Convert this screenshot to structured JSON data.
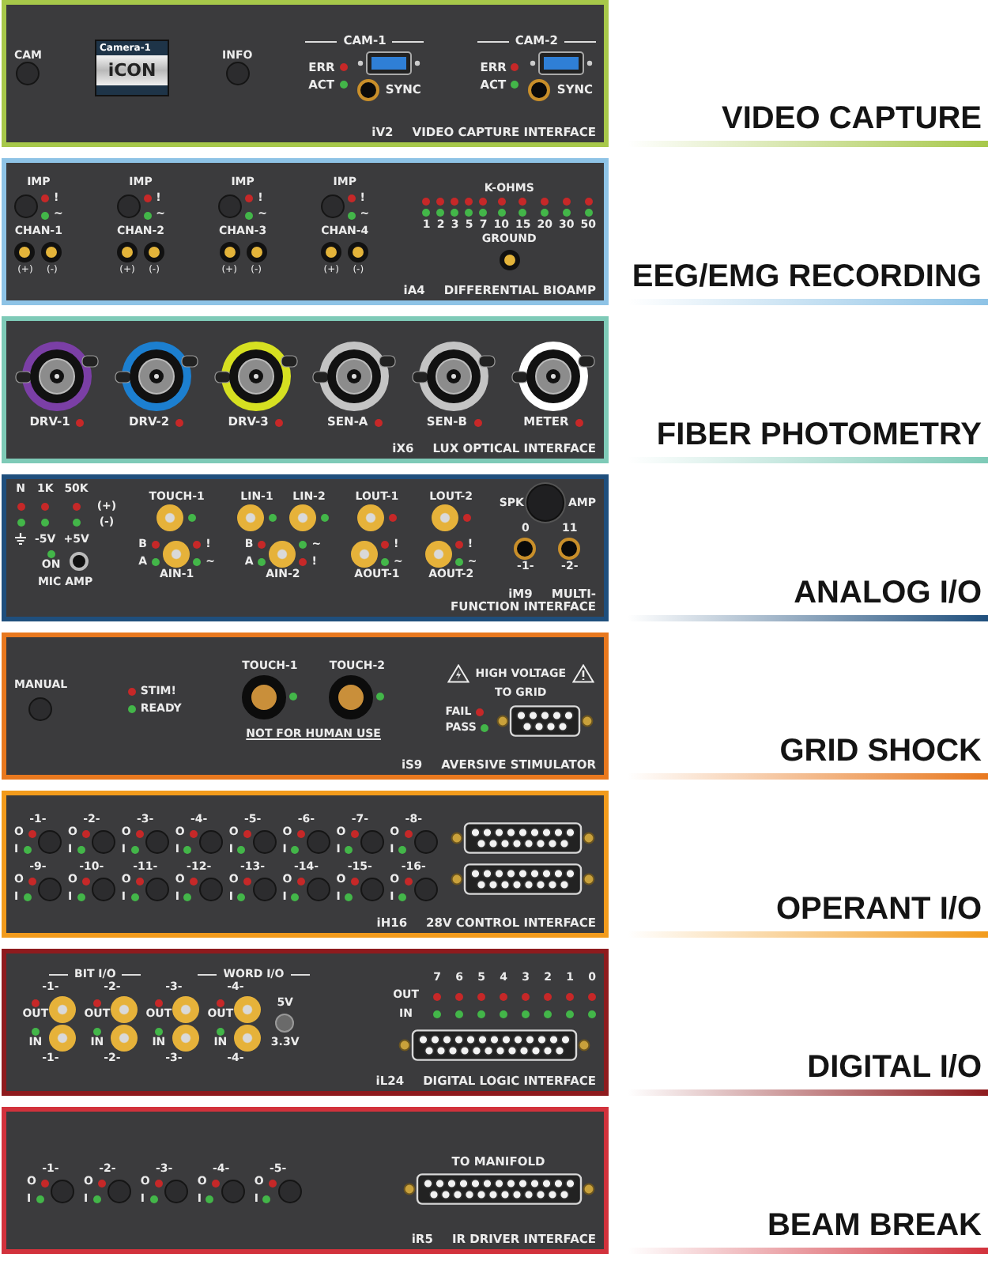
{
  "modules": [
    {
      "kind": "video",
      "color": "#a7c84a",
      "category": "VIDEO CAPTURE",
      "model": "iV2",
      "name": "VIDEO CAPTURE INTERFACE",
      "buttons": [
        "CAM",
        "INFO"
      ],
      "display": {
        "caption": "Camera-1",
        "logo": "iCON"
      },
      "cams": [
        {
          "label": "CAM-1",
          "leds": [
            {
              "label": "ERR",
              "color": "#c62828"
            },
            {
              "label": "ACT",
              "color": "#43b649"
            }
          ],
          "sync": "SYNC"
        },
        {
          "label": "CAM-2",
          "leds": [
            {
              "label": "ERR",
              "color": "#c62828"
            },
            {
              "label": "ACT",
              "color": "#43b649"
            }
          ],
          "sync": "SYNC"
        }
      ]
    },
    {
      "kind": "bioamp",
      "color": "#8ec3e6",
      "category": "EEG/EMG RECORDING",
      "model": "iA4",
      "name": "DIFFERENTIAL BIOAMP",
      "channels": [
        {
          "imp": "IMP",
          "leds": [
            {
              "label": "!",
              "color": "#c62828"
            },
            {
              "label": "~",
              "color": "#43b649"
            }
          ],
          "label": "CHAN-1",
          "jacks": [
            "(+)",
            "(-)"
          ]
        },
        {
          "imp": "IMP",
          "leds": [
            {
              "label": "!",
              "color": "#c62828"
            },
            {
              "label": "~",
              "color": "#43b649"
            }
          ],
          "label": "CHAN-2",
          "jacks": [
            "(+)",
            "(-)"
          ]
        },
        {
          "imp": "IMP",
          "leds": [
            {
              "label": "!",
              "color": "#c62828"
            },
            {
              "label": "~",
              "color": "#43b649"
            }
          ],
          "label": "CHAN-3",
          "jacks": [
            "(+)",
            "(-)"
          ]
        },
        {
          "imp": "IMP",
          "leds": [
            {
              "label": "!",
              "color": "#c62828"
            },
            {
              "label": "~",
              "color": "#43b649"
            }
          ],
          "label": "CHAN-4",
          "jacks": [
            "(+)",
            "(-)"
          ]
        }
      ],
      "scale": {
        "title": "K-OHMS",
        "values": [
          "1",
          "2",
          "3",
          "5",
          "7",
          "10",
          "15",
          "20",
          "30",
          "50"
        ],
        "leds": [
          {
            "color": "#c62828"
          },
          {
            "color": "#43b649"
          }
        ]
      },
      "ground": "GROUND"
    },
    {
      "kind": "fiber",
      "color": "#7ecab7",
      "category": "FIBER PHOTOMETRY",
      "model": "iX6",
      "name": "LUX OPTICAL INTERFACE",
      "ports": [
        {
          "label": "DRV-1",
          "color": "#7b3fa6"
        },
        {
          "label": "DRV-2",
          "color": "#1c7fd0"
        },
        {
          "label": "DRV-3",
          "color": "#d6e021"
        },
        {
          "label": "SEN-A",
          "color": "#c4c4c4"
        },
        {
          "label": "SEN-B",
          "color": "#c4c4c4"
        },
        {
          "label": "METER",
          "color": "#ffffff"
        }
      ]
    },
    {
      "kind": "analog",
      "color": "#1f4f7d",
      "category": "ANALOG I/O",
      "model": "iM9",
      "name": "MULTI-",
      "name_2": "FUNCTION INTERFACE",
      "mic": {
        "headers": [
          "N",
          "1K",
          "50K"
        ],
        "rows": [
          {
            "label": "(+)",
            "color": "#c62828"
          },
          {
            "label": "(-)",
            "color": "#43b649"
          }
        ],
        "supply": [
          "-5V",
          "+5V"
        ],
        "on": {
          "label": "ON",
          "color": "#43b649"
        },
        "caption": "MIC AMP"
      },
      "groups": [
        {
          "top": [
            {
              "label": "TOUCH-1",
              "color": "#43b649"
            }
          ],
          "bottom": [
            {
              "label": "AIN-1",
              "left": [
                {
                  "label": "B",
                  "color": "#c62828"
                },
                {
                  "label": "A",
                  "color": "#43b649"
                }
              ],
              "right": [
                {
                  "label": "!",
                  "color": "#c62828"
                },
                {
                  "label": "~",
                  "color": "#43b649"
                }
              ]
            }
          ]
        },
        {
          "top": [
            {
              "label": "LIN-1",
              "color": "#43b649"
            },
            {
              "label": "LIN-2",
              "color": "#43b649"
            }
          ],
          "bottom": [
            {
              "label": "AIN-2",
              "left": [
                {
                  "label": "B",
                  "color": "#c62828"
                },
                {
                  "label": "A",
                  "color": "#43b649"
                }
              ],
              "right": [
                {
                  "label": "~",
                  "color": "#43b649"
                },
                {
                  "label": "!",
                  "color": "#c62828"
                }
              ]
            }
          ]
        },
        {
          "top": [
            {
              "label": "LOUT-1",
              "color": "#c62828"
            }
          ],
          "bottom": [
            {
              "label": "AOUT-1",
              "right": [
                {
                  "label": "!",
                  "color": "#c62828"
                },
                {
                  "label": "~",
                  "color": "#43b649"
                }
              ]
            }
          ]
        },
        {
          "top": [
            {
              "label": "LOUT-2",
              "color": "#c62828"
            }
          ],
          "bottom": [
            {
              "label": "AOUT-2",
              "right": [
                {
                  "label": "!",
                  "color": "#c62828"
                },
                {
                  "label": "~",
                  "color": "#43b649"
                }
              ]
            }
          ]
        }
      ],
      "amp": {
        "left": "SPK",
        "right": "AMP",
        "scale": [
          "0",
          "11"
        ],
        "jacks": [
          "-1-",
          "-2-"
        ]
      }
    },
    {
      "kind": "shock",
      "color": "#e8781e",
      "category": "GRID SHOCK",
      "model": "iS9",
      "name": "AVERSIVE STIMULATOR",
      "manual": "MANUAL",
      "leds": [
        {
          "label": "STIM!",
          "color": "#c62828"
        },
        {
          "label": "READY",
          "color": "#43b649"
        }
      ],
      "touches": [
        {
          "label": "TOUCH-1",
          "color": "#43b649"
        },
        {
          "label": "TOUCH-2",
          "color": "#43b649"
        }
      ],
      "warning": "NOT FOR HUMAN USE",
      "hv": "HIGH VOLTAGE",
      "connector": "TO GRID",
      "checks": [
        {
          "label": "FAIL",
          "color": "#c62828"
        },
        {
          "label": "PASS",
          "color": "#43b649"
        }
      ]
    },
    {
      "kind": "operant",
      "color": "#f29b1c",
      "category": "OPERANT I/O",
      "model": "iH16",
      "name": "28V CONTROL INTERFACE",
      "channels": [
        {
          "label": "-1-",
          "leds": [
            {
              "label": "O",
              "color": "#c62828"
            },
            {
              "label": "I",
              "color": "#43b649"
            }
          ]
        },
        {
          "label": "-2-",
          "leds": [
            {
              "label": "O",
              "color": "#c62828"
            },
            {
              "label": "I",
              "color": "#43b649"
            }
          ]
        },
        {
          "label": "-3-",
          "leds": [
            {
              "label": "O",
              "color": "#c62828"
            },
            {
              "label": "I",
              "color": "#43b649"
            }
          ]
        },
        {
          "label": "-4-",
          "leds": [
            {
              "label": "O",
              "color": "#c62828"
            },
            {
              "label": "I",
              "color": "#43b649"
            }
          ]
        },
        {
          "label": "-5-",
          "leds": [
            {
              "label": "O",
              "color": "#c62828"
            },
            {
              "label": "I",
              "color": "#43b649"
            }
          ]
        },
        {
          "label": "-6-",
          "leds": [
            {
              "label": "O",
              "color": "#c62828"
            },
            {
              "label": "I",
              "color": "#43b649"
            }
          ]
        },
        {
          "label": "-7-",
          "leds": [
            {
              "label": "O",
              "color": "#c62828"
            },
            {
              "label": "I",
              "color": "#43b649"
            }
          ]
        },
        {
          "label": "-8-",
          "leds": [
            {
              "label": "O",
              "color": "#c62828"
            },
            {
              "label": "I",
              "color": "#43b649"
            }
          ]
        },
        {
          "label": "-9-",
          "leds": [
            {
              "label": "O",
              "color": "#c62828"
            },
            {
              "label": "I",
              "color": "#43b649"
            }
          ]
        },
        {
          "label": "-10-",
          "leds": [
            {
              "label": "O",
              "color": "#c62828"
            },
            {
              "label": "I",
              "color": "#43b649"
            }
          ]
        },
        {
          "label": "-11-",
          "leds": [
            {
              "label": "O",
              "color": "#c62828"
            },
            {
              "label": "I",
              "color": "#43b649"
            }
          ]
        },
        {
          "label": "-12-",
          "leds": [
            {
              "label": "O",
              "color": "#c62828"
            },
            {
              "label": "I",
              "color": "#43b649"
            }
          ]
        },
        {
          "label": "-13-",
          "leds": [
            {
              "label": "O",
              "color": "#c62828"
            },
            {
              "label": "I",
              "color": "#43b649"
            }
          ]
        },
        {
          "label": "-14-",
          "leds": [
            {
              "label": "O",
              "color": "#c62828"
            },
            {
              "label": "I",
              "color": "#43b649"
            }
          ]
        },
        {
          "label": "-15-",
          "leds": [
            {
              "label": "O",
              "color": "#c62828"
            },
            {
              "label": "I",
              "color": "#43b649"
            }
          ]
        },
        {
          "label": "-16-",
          "leds": [
            {
              "label": "O",
              "color": "#c62828"
            },
            {
              "label": "I",
              "color": "#43b649"
            }
          ]
        }
      ]
    },
    {
      "kind": "digital",
      "color": "#8e1b1e",
      "category": "DIGITAL I/O",
      "model": "iL24",
      "name": "DIGITAL LOGIC INTERFACE",
      "bit_label": "BIT I/O",
      "word_label": "WORD I/O",
      "bits": [
        {
          "top": "-1-",
          "io": [
            {
              "label": "OUT",
              "color": "#c62828"
            },
            {
              "label": "IN",
              "color": "#43b649"
            }
          ],
          "bottom": "-1-"
        },
        {
          "top": "-2-",
          "io": [
            {
              "label": "OUT",
              "color": "#c62828"
            },
            {
              "label": "IN",
              "color": "#43b649"
            }
          ],
          "bottom": "-2-"
        },
        {
          "top": "-3-",
          "io": [
            {
              "label": "OUT",
              "color": "#c62828"
            },
            {
              "label": "IN",
              "color": "#43b649"
            }
          ],
          "bottom": "-3-"
        },
        {
          "top": "-4-",
          "io": [
            {
              "label": "OUT",
              "color": "#c62828"
            },
            {
              "label": "IN",
              "color": "#43b649"
            }
          ],
          "bottom": "-4-"
        }
      ],
      "voltages": [
        "5V",
        "3.3V"
      ],
      "word_bits": [
        "7",
        "6",
        "5",
        "4",
        "3",
        "2",
        "1",
        "0"
      ],
      "io": [
        {
          "label": "OUT",
          "color": "#c62828"
        },
        {
          "label": "IN",
          "color": "#43b649"
        }
      ]
    },
    {
      "kind": "beam",
      "color": "#d2323c",
      "category": "BEAM BREAK",
      "model": "iR5",
      "name": "IR DRIVER INTERFACE",
      "channels": [
        {
          "label": "-1-",
          "leds": [
            {
              "label": "O",
              "color": "#c62828"
            },
            {
              "label": "I",
              "color": "#43b649"
            }
          ]
        },
        {
          "label": "-2-",
          "leds": [
            {
              "label": "O",
              "color": "#c62828"
            },
            {
              "label": "I",
              "color": "#43b649"
            }
          ]
        },
        {
          "label": "-3-",
          "leds": [
            {
              "label": "O",
              "color": "#c62828"
            },
            {
              "label": "I",
              "color": "#43b649"
            }
          ]
        },
        {
          "label": "-4-",
          "leds": [
            {
              "label": "O",
              "color": "#c62828"
            },
            {
              "label": "I",
              "color": "#43b649"
            }
          ]
        },
        {
          "label": "-5-",
          "leds": [
            {
              "label": "O",
              "color": "#c62828"
            },
            {
              "label": "I",
              "color": "#43b649"
            }
          ]
        }
      ],
      "connector": "TO MANIFOLD"
    }
  ]
}
